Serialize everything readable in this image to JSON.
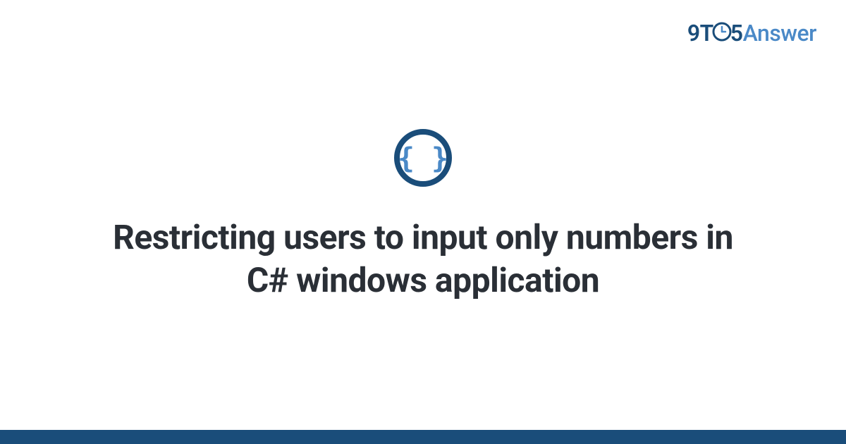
{
  "brand": {
    "prefix": "9T",
    "middle": "5",
    "suffix": "Answer"
  },
  "icon": {
    "name": "code-braces"
  },
  "title": "Restricting users to input only numbers in C# windows application",
  "colors": {
    "dark_blue": "#1a4d7a",
    "light_blue": "#4a89c7",
    "text": "#2a2f36"
  }
}
